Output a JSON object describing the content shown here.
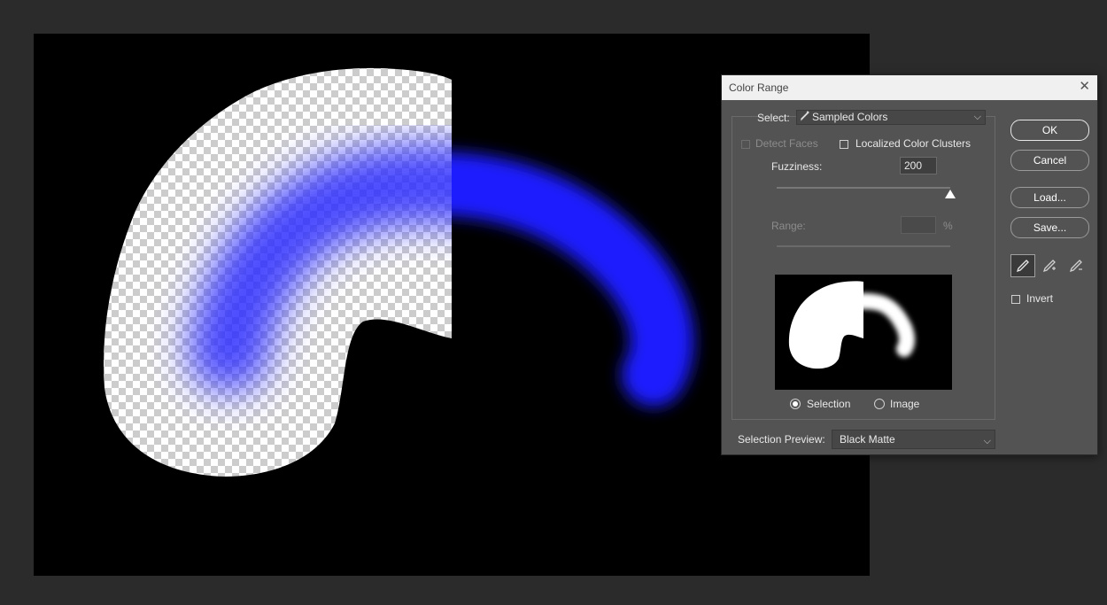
{
  "dialog": {
    "title": "Color Range",
    "select_label": "Select:",
    "select_value": "Sampled Colors",
    "detect_faces_label": "Detect Faces",
    "localized_clusters_label": "Localized Color Clusters",
    "fuzziness_label": "Fuzziness:",
    "fuzziness_value": "200",
    "fuzziness_fraction": 1.0,
    "range_label": "Range:",
    "range_value": "",
    "range_unit": "%",
    "preview_mode_selection": "Selection",
    "preview_mode_image": "Image",
    "preview_mode_selected": "Selection",
    "selection_preview_label": "Selection Preview:",
    "selection_preview_value": "Black Matte",
    "buttons": {
      "ok": "OK",
      "cancel": "Cancel",
      "load": "Load...",
      "save": "Save..."
    },
    "tools": [
      "eyedropper-icon",
      "eyedropper-add-icon",
      "eyedropper-subtract-icon"
    ],
    "invert_label": "Invert"
  },
  "colors": {
    "workspace": "#2b2b2b",
    "canvas_bg": "#000000",
    "stroke": "#1a1aff",
    "dialog_bg": "#535353"
  }
}
